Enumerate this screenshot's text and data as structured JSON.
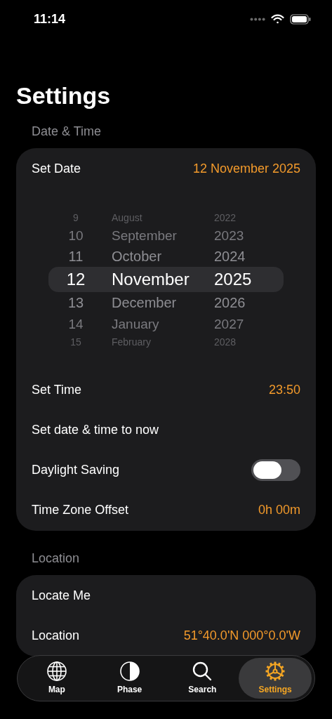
{
  "status_bar": {
    "time": "11:14"
  },
  "title": "Settings",
  "sections": [
    {
      "header": "Date & Time",
      "rows": [
        {
          "kind": "value",
          "label": "Set Date",
          "value": "12 November 2025"
        },
        {
          "kind": "picker",
          "picker_rows": [
            {
              "day": "9",
              "month": "August",
              "year": "2022",
              "selected": false
            },
            {
              "day": "10",
              "month": "September",
              "year": "2023",
              "selected": false
            },
            {
              "day": "11",
              "month": "October",
              "year": "2024",
              "selected": false
            },
            {
              "day": "12",
              "month": "November",
              "year": "2025",
              "selected": true
            },
            {
              "day": "13",
              "month": "December",
              "year": "2026",
              "selected": false
            },
            {
              "day": "14",
              "month": "January",
              "year": "2027",
              "selected": false
            },
            {
              "day": "15",
              "month": "February",
              "year": "2028",
              "selected": false
            }
          ]
        },
        {
          "kind": "value",
          "label": "Set Time",
          "value": "23:50"
        },
        {
          "kind": "action",
          "label": "Set date & time to now"
        },
        {
          "kind": "toggle",
          "label": "Daylight Saving",
          "on": false
        },
        {
          "kind": "value",
          "label": "Time Zone Offset",
          "value": "0h 00m"
        }
      ]
    },
    {
      "header": "Location",
      "rows": [
        {
          "kind": "action",
          "label": "Locate Me"
        },
        {
          "kind": "value",
          "label": "Location",
          "value": "51°40.0'N 000°0.0'W"
        }
      ]
    }
  ],
  "tab_bar": [
    {
      "label": "Map",
      "selected": false
    },
    {
      "label": "Phase",
      "selected": false
    },
    {
      "label": "Search",
      "selected": false
    },
    {
      "label": "Settings",
      "selected": true
    }
  ]
}
